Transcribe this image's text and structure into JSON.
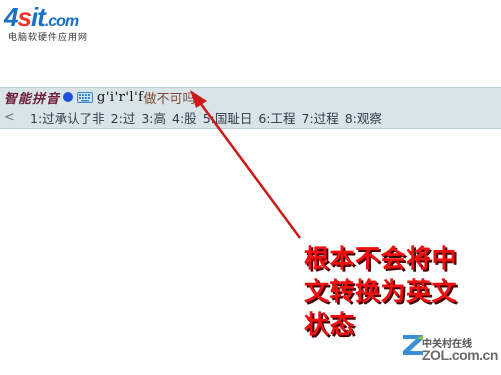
{
  "logo": {
    "mark_num": "4",
    "mark_s": "s",
    "mark_it": "it",
    "mark_com": ".com",
    "subtitle": "电脑软硬件应用网"
  },
  "ime": {
    "name": "智能拼音",
    "pinyin": "g'i'r'l'f",
    "preedit": "做不可吗",
    "prev_arrow": "<",
    "candidates": [
      "1:过承认了非",
      "2:过",
      "3:高",
      "4:股",
      "5:国耻日",
      "6:工程",
      "7:过程",
      "8:观察"
    ]
  },
  "annotation": {
    "lines": [
      "根本不会将中",
      "文转换为英文",
      "状态"
    ]
  },
  "watermark": {
    "cn": "中关村在线",
    "en": "ZOL.com.cn"
  },
  "colors": {
    "annotation_red": "#f01010",
    "ime_bar_bg": "#d9e4e8",
    "logo_blue": "#1a6fc7",
    "logo_red": "#e9352a"
  },
  "icons": {
    "ime_status": "blue-dot-icon",
    "soft_keyboard": "keyboard-icon",
    "pointer": "red-arrow-icon",
    "watermark_logo": "zol-z-icon"
  }
}
